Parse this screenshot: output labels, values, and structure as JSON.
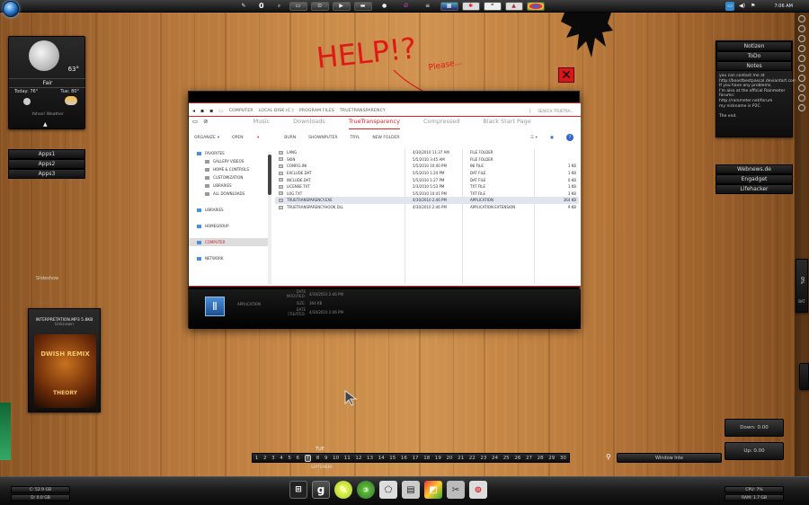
{
  "topbar": {
    "counter": "0",
    "clock": "7:06 AM",
    "buttons": [
      "pencil",
      "search",
      "window",
      "dots",
      "play",
      "folder",
      "avatar",
      "stats",
      "windows",
      "star",
      "quote",
      "shield",
      "chrome"
    ]
  },
  "weather": {
    "condition": "Fair",
    "temp": "63°",
    "today_label": "Today: 76°",
    "tomorrow_label": "Tue: 80°",
    "source": "Yahoo! Weather"
  },
  "apps": [
    "Apps1",
    "Apps2",
    "Apps3"
  ],
  "slideshow_label": "Slideshow",
  "music": {
    "title": "INTERPRETATION.MP3 5.8KB",
    "subtitle": "Unknown",
    "album_text": "DWISH REMIX",
    "album_sub": "THEORY"
  },
  "notes_widget": {
    "buttons": [
      "Notizen",
      "ToDo",
      "Notes"
    ],
    "body": "you can contact me at http://boostbestpascal.deviantart.com\nIf you have any problems.\nI'm also at the official Rainmeter forums:\nhttp://rainmeter.net/forum\nmy nickname is P2C.\n\nThe end."
  },
  "links_widget": [
    "Webnews.de",
    "Engadget",
    "Lifehacker"
  ],
  "annotation": {
    "text": "HELP!?",
    "sub": "Please..."
  },
  "explorer": {
    "breadcrumb": [
      "COMPUTER",
      "LOCAL DISK (C:)",
      "PROGRAM FILES",
      "TRUETRANSPARENCY"
    ],
    "search_placeholder": "SEARCH TRUETRA...",
    "tabs": [
      "Music",
      "Downloads",
      "TrueTransparency",
      "Compressed",
      "Black Start Page"
    ],
    "active_tab": "TrueTransparency",
    "toolbar": [
      "ORGANIZE",
      "OPEN",
      "BURN",
      "NEW FOLDER"
    ],
    "toolbar_extra": [
      "BURN",
      "SHOWNPUTER",
      "TRYL"
    ],
    "sidebar": [
      {
        "label": "FAVORITES",
        "head": true
      },
      {
        "label": "GALLERY VIDEOS",
        "head": false
      },
      {
        "label": "HOME & CONTROLS",
        "head": false
      },
      {
        "label": "CUSTOMIZATION",
        "head": false
      },
      {
        "label": "LIBRARIES",
        "head": false
      },
      {
        "label": "ALL DOWNLOADS",
        "head": false
      },
      {
        "label": "",
        "head": false
      },
      {
        "label": "LIBRARIES",
        "head": true
      },
      {
        "label": "",
        "head": false
      },
      {
        "label": "HOMEGROUP",
        "head": true
      },
      {
        "label": "",
        "head": false
      },
      {
        "label": "COMPUTER",
        "head": true,
        "selected": true
      },
      {
        "label": "",
        "head": false
      },
      {
        "label": "NETWORK",
        "head": true
      }
    ],
    "files": [
      {
        "name": "LANG",
        "date": "4/30/2010 11:37 AM",
        "type": "FILE FOLDER",
        "size": ""
      },
      {
        "name": "SKIN",
        "date": "5/5/2010 3:45 AM",
        "type": "FILE FOLDER",
        "size": ""
      },
      {
        "name": "CONFIG.INI",
        "date": "5/5/2010 10:40 PM",
        "type": "INI FILE",
        "size": "1 KB"
      },
      {
        "name": "EXCLUDE.DAT",
        "date": "5/5/2010 1:24 PM",
        "type": "DAT FILE",
        "size": "1 KB"
      },
      {
        "name": "INCLUDE.DAT",
        "date": "5/5/2010 1:27 PM",
        "type": "DAT FILE",
        "size": "0 KB"
      },
      {
        "name": "LICENSE.TXT",
        "date": "2/3/2010 5:53 PM",
        "type": "TXT FILE",
        "size": "1 KB"
      },
      {
        "name": "LOG.TXT",
        "date": "5/5/2010 10:41 PM",
        "type": "TXT FILE",
        "size": "3 KB"
      },
      {
        "name": "TRUETRANSPARENCY.EXE",
        "date": "4/30/2010 2:46 PM",
        "type": "APPLICATION",
        "size": "364 KB",
        "selected": true
      },
      {
        "name": "TRUETRANSPARENCYHOOK.DLL",
        "date": "4/30/2010 2:46 PM",
        "type": "APPLICATION EXTENSION",
        "size": "9 KB"
      }
    ],
    "details": {
      "kind": "APPLICATION",
      "date_modified": "4/30/2010 2:46 PM",
      "size": "364 KB",
      "date_created": "4/30/2010 2:46 PM",
      "labels": [
        "DATE MODIFIED:",
        "SIZE:",
        "DATE CREATED:"
      ]
    }
  },
  "calendar": {
    "weekday": "TUE",
    "today": "7",
    "days": [
      "1",
      "2",
      "3",
      "4",
      "5",
      "6",
      "7",
      "8",
      "9",
      "10",
      "11",
      "12",
      "13",
      "14",
      "15",
      "16",
      "17",
      "18",
      "19",
      "20",
      "21",
      "22",
      "23",
      "24",
      "25",
      "26",
      "27",
      "28",
      "29",
      "30"
    ],
    "month": "SEPTEMBER"
  },
  "search_bottom": {
    "placeholder": "Window Inte"
  },
  "net_widget": {
    "down": "Down: 0.00",
    "up": "Up: 0.00"
  },
  "bottom_left": {
    "line1": "C: 52.9 GB",
    "line2": "D: 0.0 GB"
  },
  "bottom_right": {
    "line1": "CPU: 7%",
    "line2": "RAM: 1.7 GB"
  },
  "battery": {
    "percent": "0%",
    "label": "BAT"
  },
  "dock": [
    "network-icon",
    "google-icon",
    "tennis-icon",
    "notification-icon",
    "eraser-icon",
    "save-icon",
    "painter-icon",
    "tools-icon",
    "recorder-icon"
  ]
}
